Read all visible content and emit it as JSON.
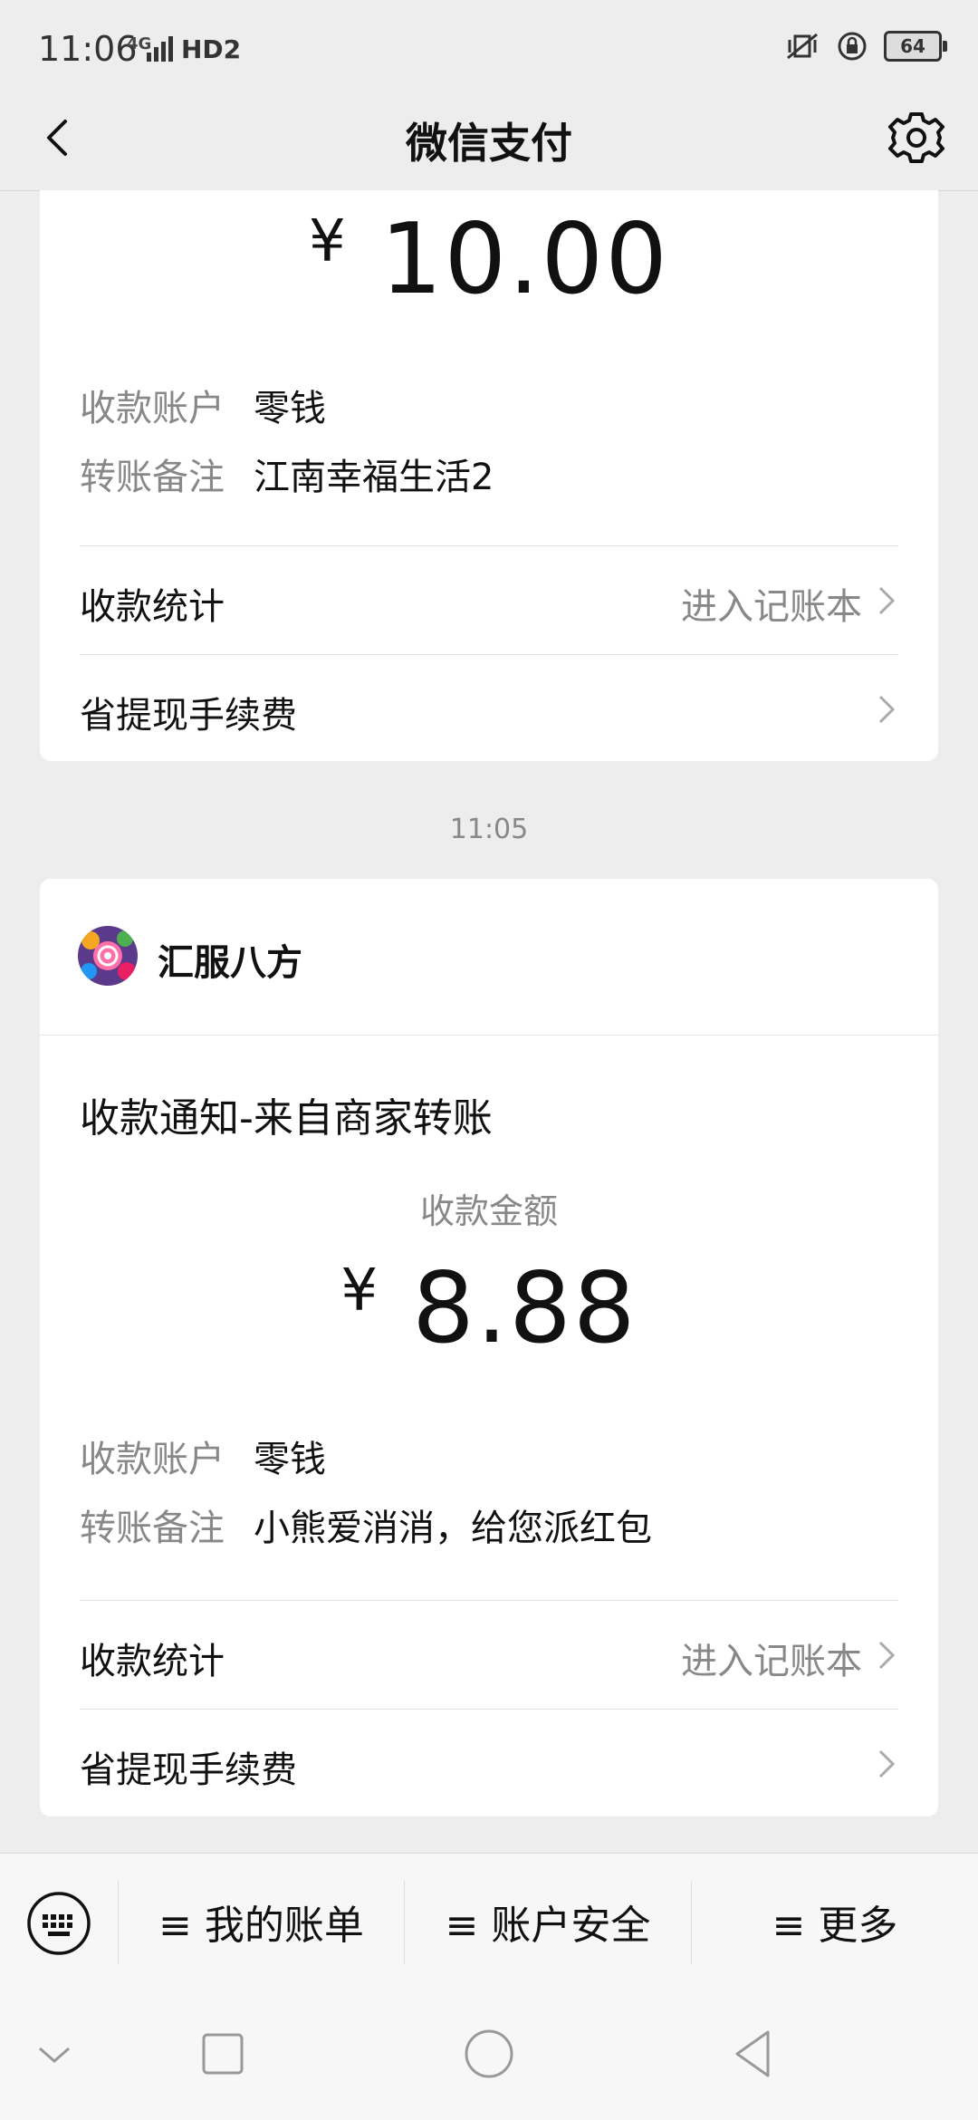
{
  "status_bar": {
    "time": "11:06",
    "network": "4G",
    "hd": "HD2",
    "battery": "64"
  },
  "header": {
    "title": "微信支付"
  },
  "card1": {
    "amount": "10.00",
    "currency": "¥",
    "account_label": "收款账户",
    "account_value": "零钱",
    "note_label": "转账备注",
    "note_value": "江南幸福生活2",
    "stats_label": "收款统计",
    "stats_action": "进入记账本",
    "fee_label": "省提现手续费"
  },
  "timestamp": "11:05",
  "card2": {
    "merchant_name": "汇服八方",
    "notice_title": "收款通知-来自商家转账",
    "amount_label": "收款金额",
    "currency": "¥",
    "amount": "8.88",
    "account_label": "收款账户",
    "account_value": "零钱",
    "note_label": "转账备注",
    "note_value": "小熊爱消消，给您派红包",
    "stats_label": "收款统计",
    "stats_action": "进入记账本",
    "fee_label": "省提现手续费"
  },
  "menu": {
    "items": [
      {
        "label": "≡ 我的账单"
      },
      {
        "label": "≡ 账户安全"
      },
      {
        "label": "≡ 更多"
      }
    ]
  },
  "colors": {
    "background": "#ededed",
    "card": "#ffffff",
    "secondary_text": "#888888"
  }
}
